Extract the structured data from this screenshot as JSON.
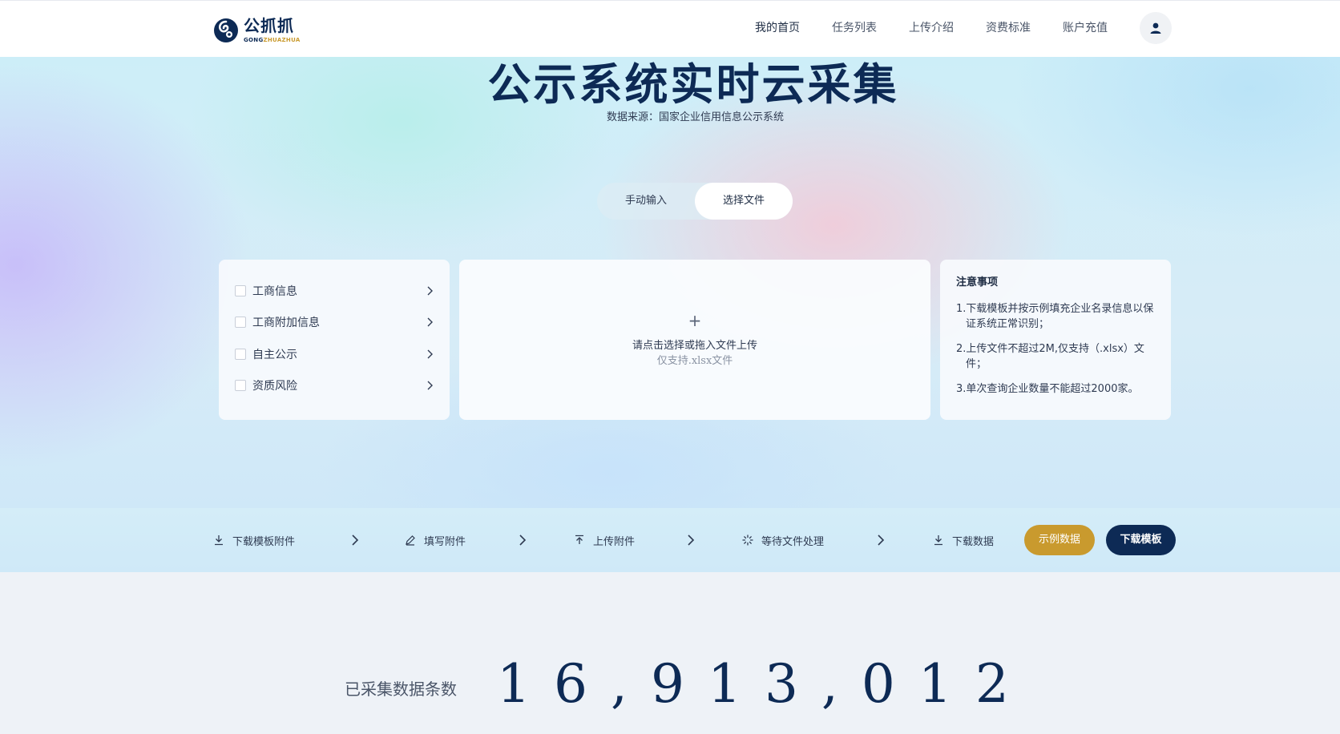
{
  "header": {
    "logo_name": "公抓抓",
    "logo_sub_main": "GONG",
    "logo_sub_accent": "ZHUAZHUA",
    "nav": [
      {
        "label": "我的首页"
      },
      {
        "label": "任务列表"
      },
      {
        "label": "上传介绍"
      },
      {
        "label": "资费标准"
      },
      {
        "label": "账户充值"
      }
    ]
  },
  "hero": {
    "title": "公示系统实时云采集",
    "subtitle": "数据来源：国家企业信用信息公示系统",
    "tabs": {
      "manual": "手动输入",
      "file": "选择文件"
    },
    "categories": [
      {
        "label": "工商信息"
      },
      {
        "label": "工商附加信息"
      },
      {
        "label": "自主公示"
      },
      {
        "label": "资质风险"
      }
    ],
    "upload": {
      "plus": "+",
      "text": "请点击选择或拖入文件上传",
      "hint": "仅支持.xlsx文件"
    },
    "notes": {
      "title": "注意事项",
      "items": [
        "1.下载模板并按示例填充企业名录信息以保证系统正常识别；",
        "2.上传文件不超过2M,仅支持（.xlsx）文件；",
        "3.单次查询企业数量不能超过2000家。"
      ]
    }
  },
  "steps": {
    "items": [
      {
        "label": "下载模板附件",
        "icon": "download-icon"
      },
      {
        "label": "填写附件",
        "icon": "pen-icon"
      },
      {
        "label": "上传附件",
        "icon": "upload-icon"
      },
      {
        "label": "等待文件处理",
        "icon": "spinner-icon"
      },
      {
        "label": "下载数据",
        "icon": "download-icon"
      }
    ],
    "sample_button": "示例数据",
    "download_button": "下载模板"
  },
  "stats": {
    "label": "已采集数据条数",
    "value": "16,913,012"
  },
  "colors": {
    "brand_navy": "#0d2a55",
    "brand_gold": "#c99a2e"
  }
}
